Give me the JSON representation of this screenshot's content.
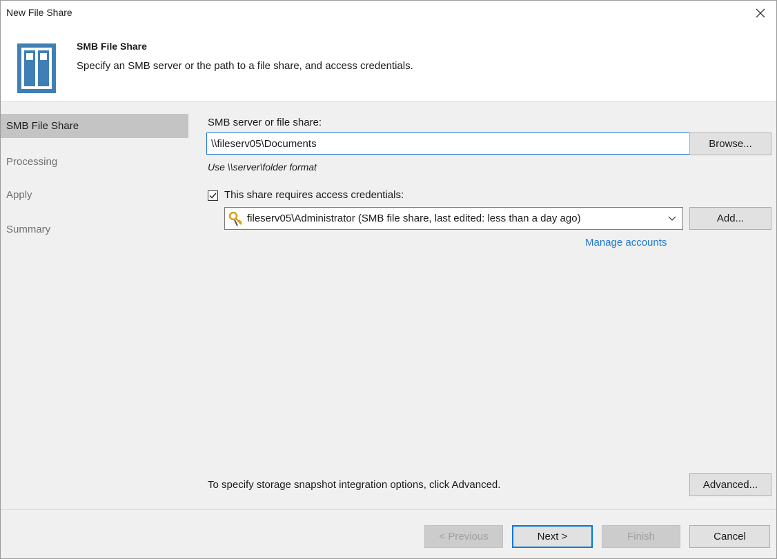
{
  "window": {
    "title": "New File Share"
  },
  "header": {
    "title": "SMB File Share",
    "subtitle": "Specify an SMB server or the path to a file share, and access credentials."
  },
  "sidebar": {
    "items": [
      {
        "label": "SMB File Share",
        "active": true
      },
      {
        "label": "Processing",
        "active": false
      },
      {
        "label": "Apply",
        "active": false
      },
      {
        "label": "Summary",
        "active": false
      }
    ]
  },
  "form": {
    "share_label": "SMB server or file share:",
    "share_value": "\\\\fileserv05\\Documents",
    "browse_label": "Browse...",
    "format_hint": "Use \\\\server\\folder format",
    "credentials_checkbox_label": "This share requires access credentials:",
    "credentials_checked": true,
    "credentials_selected": "fileserv05\\Administrator (SMB file share, last edited: less than a day ago)",
    "add_label": "Add...",
    "manage_accounts_label": "Manage accounts",
    "advanced_hint": "To specify storage snapshot integration options, click Advanced.",
    "advanced_label": "Advanced..."
  },
  "footer": {
    "previous_label": "< Previous",
    "next_label": "Next >",
    "finish_label": "Finish",
    "cancel_label": "Cancel"
  },
  "colors": {
    "accent": "#1e78d2",
    "sidebar_active": "#c4c4c4",
    "icon_blue": "#3f7fb5",
    "key_gold": "#d4a017"
  },
  "icons": {
    "header": "server-rack-icon",
    "close": "close-icon",
    "credentials": "key-icon",
    "dropdown": "chevron-down-icon",
    "checkbox": "checkmark-icon"
  }
}
